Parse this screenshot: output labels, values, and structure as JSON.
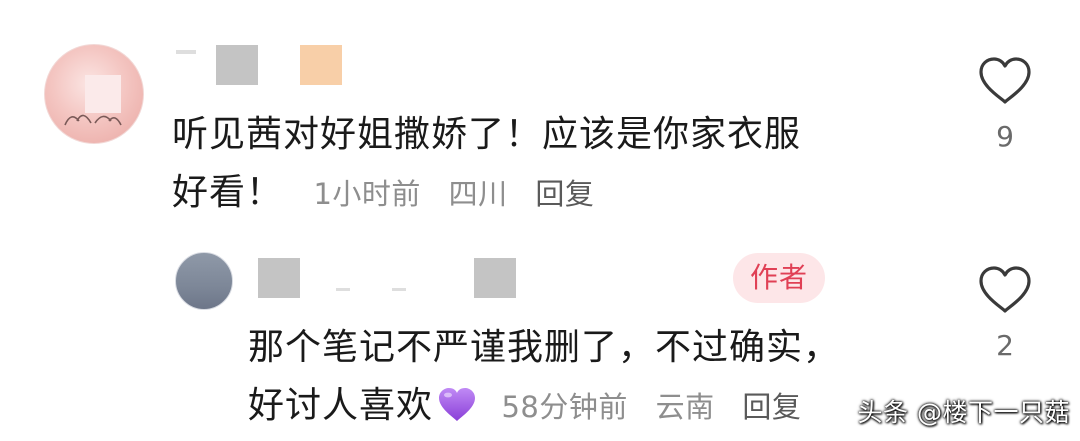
{
  "comments": [
    {
      "text_line1": "听见茜对好姐撒娇了！应该是你家衣服",
      "text_line2": "好看！",
      "time": "1小时前",
      "location": "四川",
      "reply_label": "回复",
      "like_count": "9",
      "like_icon": "heart-outline-icon"
    },
    {
      "badge": "作者",
      "text_line1": "那个笔记不严谨我删了，不过确实，",
      "text_line2": "好讨人喜欢",
      "emoji": "purple-heart-icon",
      "time": "58分钟前",
      "location": "云南",
      "reply_label": "回复",
      "like_count": "2",
      "like_icon": "heart-outline-icon"
    }
  ],
  "watermark": "头条 @楼下一只菇",
  "colors": {
    "text": "#1a1a1a",
    "meta": "#8e8e8e",
    "badge_bg": "#fde6e8",
    "badge_text": "#e04055",
    "purple_heart": "#a259e6"
  }
}
